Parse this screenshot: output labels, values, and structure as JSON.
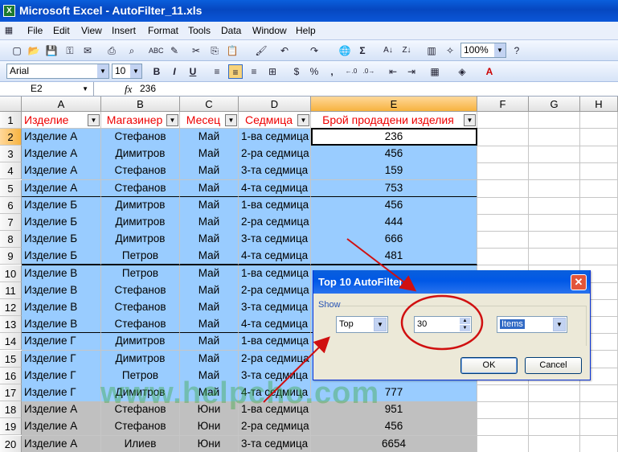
{
  "window": {
    "title": "Microsoft Excel - AutoFilter_11.xls",
    "app_icon": "X"
  },
  "menu": [
    "File",
    "Edit",
    "View",
    "Insert",
    "Format",
    "Tools",
    "Data",
    "Window",
    "Help"
  ],
  "toolbar": {
    "zoom": "100%",
    "font_name": "Arial",
    "font_size": "10",
    "bold": "B",
    "italic": "I",
    "underline": "U",
    "sum": "Σ",
    "percent": "%",
    "comma": ","
  },
  "formula_bar": {
    "cell_ref": "E2",
    "fx": "fx",
    "value": "236"
  },
  "columns": [
    "A",
    "B",
    "C",
    "D",
    "E",
    "F",
    "G",
    "H"
  ],
  "headers": [
    "Изделие",
    "Магазинер",
    "Месец",
    "Седмица",
    "Брой продадени изделия"
  ],
  "rows": [
    {
      "n": "2",
      "cells": [
        "Изделие А",
        "Стефанов",
        "Май",
        "1-ва седмица",
        "236"
      ]
    },
    {
      "n": "3",
      "cells": [
        "Изделие А",
        "Димитров",
        "Май",
        "2-ра седмица",
        "456"
      ]
    },
    {
      "n": "4",
      "cells": [
        "Изделие А",
        "Стефанов",
        "Май",
        "3-та седмица",
        "159"
      ]
    },
    {
      "n": "5",
      "cells": [
        "Изделие А",
        "Стефанов",
        "Май",
        "4-та седмица",
        "753"
      ]
    },
    {
      "n": "6",
      "cells": [
        "Изделие Б",
        "Димитров",
        "Май",
        "1-ва седмица",
        "456"
      ]
    },
    {
      "n": "7",
      "cells": [
        "Изделие Б",
        "Димитров",
        "Май",
        "2-ра седмица",
        "444"
      ]
    },
    {
      "n": "8",
      "cells": [
        "Изделие Б",
        "Димитров",
        "Май",
        "3-та седмица",
        "666"
      ]
    },
    {
      "n": "9",
      "cells": [
        "Изделие Б",
        "Петров",
        "Май",
        "4-та седмица",
        "481"
      ]
    },
    {
      "n": "10",
      "cells": [
        "Изделие В",
        "Петров",
        "Май",
        "1-ва седмица",
        ""
      ]
    },
    {
      "n": "11",
      "cells": [
        "Изделие В",
        "Стефанов",
        "Май",
        "2-ра седмица",
        ""
      ]
    },
    {
      "n": "12",
      "cells": [
        "Изделие В",
        "Стефанов",
        "Май",
        "3-та седмица",
        ""
      ]
    },
    {
      "n": "13",
      "cells": [
        "Изделие В",
        "Стефанов",
        "Май",
        "4-та седмица",
        ""
      ]
    },
    {
      "n": "14",
      "cells": [
        "Изделие Г",
        "Димитров",
        "Май",
        "1-ва седмица",
        ""
      ]
    },
    {
      "n": "15",
      "cells": [
        "Изделие Г",
        "Димитров",
        "Май",
        "2-ра седмица",
        ""
      ]
    },
    {
      "n": "16",
      "cells": [
        "Изделие Г",
        "Петров",
        "Май",
        "3-та седмица",
        ""
      ]
    },
    {
      "n": "17",
      "cells": [
        "Изделие Г",
        "Димитров",
        "Май",
        "4-та седмица",
        "777"
      ]
    },
    {
      "n": "18",
      "cells": [
        "Изделие А",
        "Стефанов",
        "Юни",
        "1-ва седмица",
        "951"
      ]
    },
    {
      "n": "19",
      "cells": [
        "Изделие А",
        "Стефанов",
        "Юни",
        "2-ра седмица",
        "456"
      ]
    },
    {
      "n": "20",
      "cells": [
        "Изделие А",
        "Илиев",
        "Юни",
        "3-та седмица",
        "6654"
      ]
    }
  ],
  "highlight_colors": {
    "filtered": "#99ccff",
    "other": "#c0c0c0",
    "header_text": "#ff0000",
    "annotation": "#d01010"
  },
  "dialog": {
    "title": "Top 10 AutoFilter",
    "group_label": "Show",
    "direction": "Top",
    "count": "30",
    "unit": "Items",
    "ok": "OK",
    "cancel": "Cancel"
  },
  "watermark": "www.helpcho.com"
}
